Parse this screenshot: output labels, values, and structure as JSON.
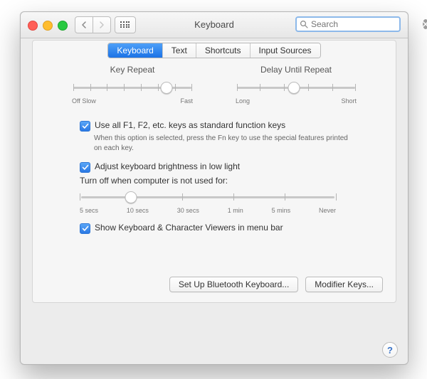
{
  "window": {
    "title": "Keyboard",
    "search_placeholder": "Search"
  },
  "tabs": [
    "Keyboard",
    "Text",
    "Shortcuts",
    "Input Sources"
  ],
  "sliders": {
    "key_repeat": {
      "label": "Key Repeat",
      "min": "Off Slow",
      "max": "Fast",
      "ticks": 8,
      "value_index": 6
    },
    "delay_repeat": {
      "label": "Delay Until Repeat",
      "min": "Long",
      "max": "Short",
      "ticks": 6,
      "value_index": 2
    }
  },
  "options": {
    "fn_keys": {
      "checked": true,
      "label": "Use all F1, F2, etc. keys as standard function keys",
      "hint": "When this option is selected, press the Fn key to use the special features printed on each key."
    },
    "brightness": {
      "checked": true,
      "label": "Adjust keyboard brightness in low light"
    },
    "idle_off": {
      "label": "Turn off when computer is not used for:",
      "ticks": [
        "5 secs",
        "10 secs",
        "30 secs",
        "1 min",
        "5 mins",
        "Never"
      ],
      "value_index": 1
    },
    "viewers": {
      "checked": true,
      "label": "Show Keyboard & Character Viewers in menu bar"
    }
  },
  "buttons": {
    "bluetooth": "Set Up Bluetooth Keyboard...",
    "modifier": "Modifier Keys...",
    "help": "?"
  }
}
